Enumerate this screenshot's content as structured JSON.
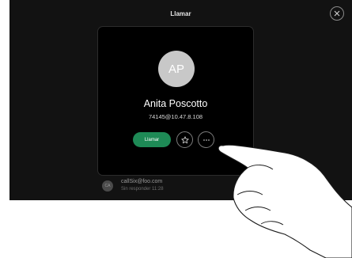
{
  "header": {
    "title": "Llamar"
  },
  "contact": {
    "initials": "AP",
    "name": "Anita Poscotto",
    "address": "74145@10.47.8.108"
  },
  "actions": {
    "call_label": "Llamar"
  },
  "recent": {
    "initials": "CA",
    "address": "callSix@foo.com",
    "status": "Sin responder 11:28"
  },
  "colors": {
    "call_button": "#1e8a56",
    "background": "#121212",
    "card": "#000000"
  },
  "icons": [
    "close-icon",
    "star-icon",
    "more-icon"
  ]
}
